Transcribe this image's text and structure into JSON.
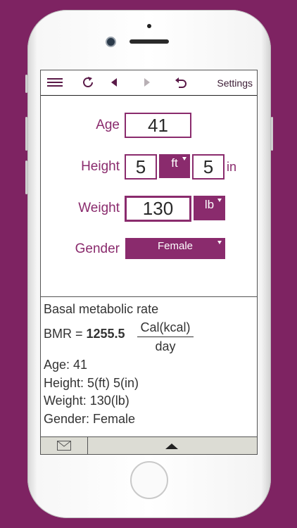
{
  "toolbar": {
    "menu_icon": "hamburger-menu-icon",
    "refresh_icon": "refresh-icon",
    "back_icon": "triangle-left-icon",
    "forward_icon": "triangle-right-icon",
    "undo_icon": "undo-icon",
    "settings_label": "Settings"
  },
  "form": {
    "age_label": "Age",
    "age_value": "41",
    "height_label": "Height",
    "height_ft_value": "5",
    "height_ft_unit": "ft",
    "height_in_value": "5",
    "height_in_unit": "in",
    "weight_label": "Weight",
    "weight_value": "130",
    "weight_unit": "lb",
    "gender_label": "Gender",
    "gender_value": "Female"
  },
  "results": {
    "heading": "Basal metabolic rate",
    "bmr_prefix": "BMR = ",
    "bmr_value": "1255.5",
    "unit_numerator": "Cal(kcal)",
    "unit_denominator": "day",
    "age_line": "Age: 41",
    "height_line": "Height: 5(ft) 5(in)",
    "weight_line": "Weight: 130(lb)",
    "gender_line": "Gender: Female"
  },
  "bottom_bar": {
    "mail_icon": "mail-icon",
    "expand_icon": "triangle-up-icon"
  },
  "colors": {
    "background": "#7e2362",
    "accent": "#8a2b6d"
  }
}
